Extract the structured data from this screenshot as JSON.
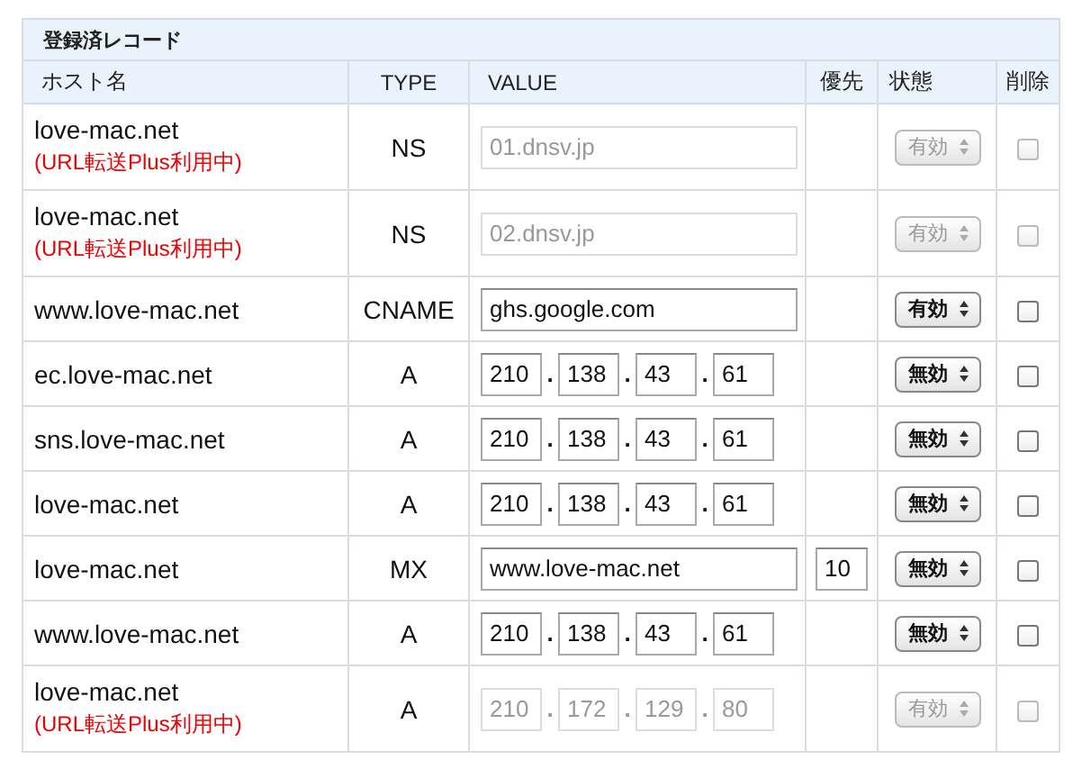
{
  "section_title": "登録済レコード",
  "columns": [
    "ホスト名",
    "TYPE",
    "VALUE",
    "優先",
    "状態",
    "削除"
  ],
  "rows": [
    {
      "host": "love-mac.net",
      "note": "(URL転送Plus利用中)",
      "type": "NS",
      "kind": "text",
      "value": "01.dnsv.jp",
      "status": "有効",
      "disabled": true,
      "checked": false
    },
    {
      "host": "love-mac.net",
      "note": "(URL転送Plus利用中)",
      "type": "NS",
      "kind": "text",
      "value": "02.dnsv.jp",
      "status": "有効",
      "disabled": true,
      "checked": false
    },
    {
      "host": "www.love-mac.net",
      "type": "CNAME",
      "kind": "text",
      "value": "ghs.google.com",
      "status": "有効",
      "disabled": false,
      "checked": false
    },
    {
      "host": "ec.love-mac.net",
      "type": "A",
      "kind": "ip",
      "octets": [
        "210",
        "138",
        "43",
        "61"
      ],
      "separators": [
        ".",
        ".",
        "."
      ],
      "status": "無効",
      "disabled": false,
      "checked": false
    },
    {
      "host": "sns.love-mac.net",
      "type": "A",
      "kind": "ip",
      "octets": [
        "210",
        "138",
        "43",
        "61"
      ],
      "separators": [
        ".",
        ".",
        "."
      ],
      "status": "無効",
      "disabled": false,
      "checked": false
    },
    {
      "host": "love-mac.net",
      "type": "A",
      "kind": "ip",
      "octets": [
        "210",
        "138",
        "43",
        "61"
      ],
      "separators": [
        ".",
        ".",
        "."
      ],
      "status": "無効",
      "disabled": false,
      "checked": false
    },
    {
      "host": "love-mac.net",
      "type": "MX",
      "kind": "text",
      "value": "www.love-mac.net",
      "priority": "10",
      "status": "無効",
      "disabled": false,
      "checked": false
    },
    {
      "host": "www.love-mac.net",
      "type": "A",
      "kind": "ip",
      "octets": [
        "210",
        "138",
        "43",
        "61"
      ],
      "separators": [
        ".",
        ".",
        "."
      ],
      "status": "無効",
      "disabled": false,
      "checked": false
    },
    {
      "host": "love-mac.net",
      "note": "(URL転送Plus利用中)",
      "type": "A",
      "kind": "ip",
      "octets": [
        "210",
        "172",
        "129",
        "80"
      ],
      "separators": [
        ".",
        ".",
        "."
      ],
      "status": "有効",
      "disabled": true,
      "checked": false
    }
  ]
}
